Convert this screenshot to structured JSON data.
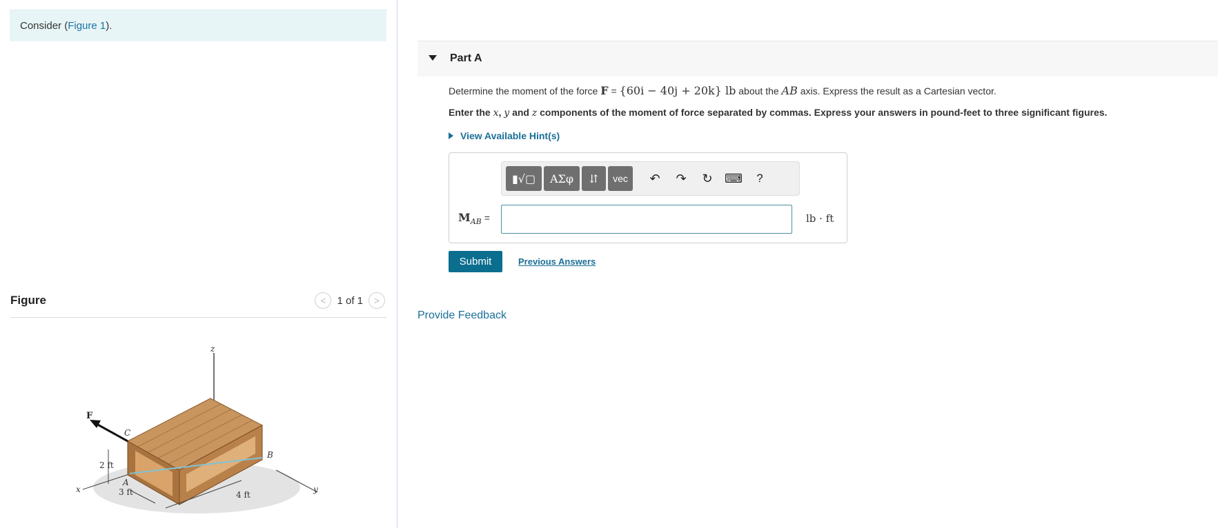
{
  "intro": {
    "prefix": "Consider (",
    "link": "Figure 1",
    "suffix": ")."
  },
  "figure": {
    "title": "Figure",
    "pager": "1 of 1",
    "labels": {
      "z": "z",
      "F": "F",
      "C": "C",
      "B": "B",
      "A": "A",
      "x": "x",
      "y": "y",
      "h": "2 ft",
      "w": "3 ft",
      "l": "4 ft"
    }
  },
  "part": {
    "title": "Part A"
  },
  "question": {
    "line1_a": "Determine the moment of the force ",
    "line1_F": "F",
    "line1_eq": " = ",
    "line1_vec": "{60i − 40j + 20k}",
    "line1_unit": " lb",
    "line1_b": " about the ",
    "line1_axis": "AB",
    "line1_c": " axis. Express the result as a Cartesian vector.",
    "line2_a": "Enter the ",
    "line2_x": "x",
    "line2_sep": ", ",
    "line2_y": "y",
    "line2_and": " and ",
    "line2_z": "z",
    "line2_b": " components of the moment of force separated  by commas. Express your answers in pound-feet to three significant figures."
  },
  "hint": {
    "label": "View Available Hint(s)"
  },
  "toolbar": {
    "templates": "▮√▢",
    "greek": "ΑΣφ",
    "arrows": "⇵",
    "vec": "vec",
    "undo": "↶",
    "redo": "↷",
    "reset": "↻",
    "keyboard": "⌨",
    "help": "?"
  },
  "answer": {
    "label_main": "M",
    "label_sub": "AB",
    "label_eq": "=",
    "value": "",
    "unit": "lb · ft"
  },
  "buttons": {
    "submit": "Submit",
    "previous": "Previous Answers"
  },
  "feedback": {
    "label": "Provide Feedback"
  },
  "colors": {
    "accent": "#0b6e8f",
    "link": "#1a6f97",
    "intro_bg": "#e8f5f6",
    "wood": "#c9955f"
  }
}
